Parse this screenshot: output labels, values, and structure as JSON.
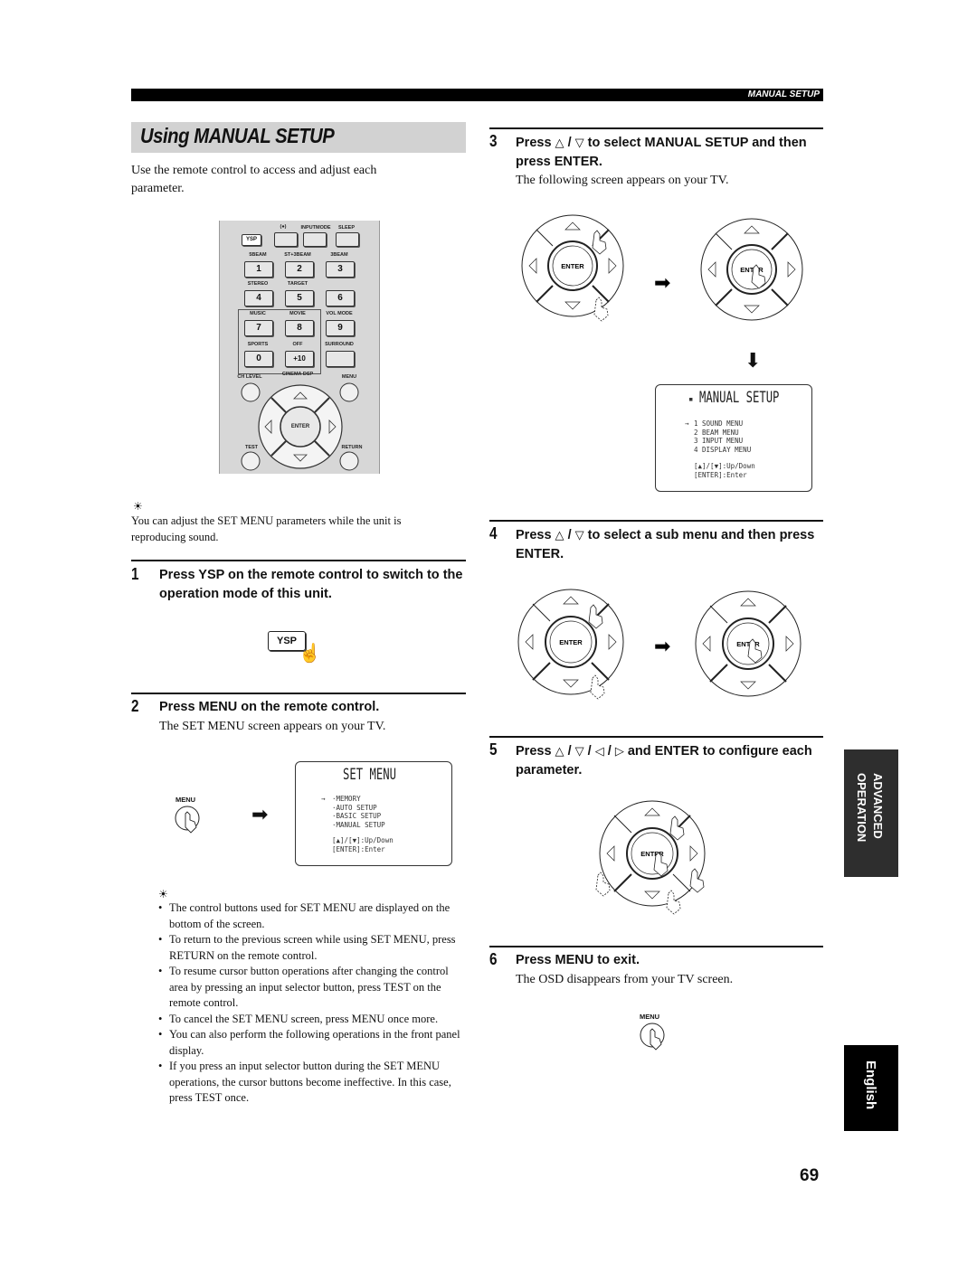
{
  "header": {
    "section_label": "MANUAL SETUP"
  },
  "title": "Using MANUAL SETUP",
  "intro": "Use the remote control to access and adjust each parameter.",
  "remote": {
    "top_labels": [
      "(●)",
      "INPUTMODE",
      "SLEEP"
    ],
    "ysp_label": "YSP",
    "row_labels_1": [
      "5BEAM",
      "ST+3BEAM",
      "3BEAM"
    ],
    "row_buttons_1": [
      "1",
      "2",
      "3"
    ],
    "row_labels_2": [
      "STEREO",
      "TARGET",
      ""
    ],
    "row_buttons_2": [
      "4",
      "5",
      "6"
    ],
    "row_labels_3": [
      "MUSIC",
      "MOVIE",
      "VOL MODE"
    ],
    "row_buttons_3": [
      "7",
      "8",
      "9"
    ],
    "row_labels_4": [
      "SPORTS",
      "OFF",
      "SURROUND"
    ],
    "row_buttons_4": [
      "0",
      "+10",
      ""
    ],
    "ch_level": "CH LEVEL",
    "cinema_dsp": "CINEMA DSP",
    "menu": "MENU",
    "enter": "ENTER",
    "test": "TEST",
    "return": "RETURN"
  },
  "tip1": {
    "icon": "tip-icon",
    "text": "You can adjust the SET MENU parameters while the unit is reproducing sound."
  },
  "steps": [
    {
      "num": "1",
      "heading": "Press YSP on the remote control to switch to the operation mode of this unit.",
      "button_label": "YSP"
    },
    {
      "num": "2",
      "heading": "Press MENU on the remote control.",
      "body": "The SET MENU screen appears on your TV.",
      "button_label": "MENU"
    },
    {
      "num": "3",
      "heading_pre": "Press",
      "heading_post": "to select MANUAL SETUP and then press ENTER.",
      "body": "The following screen appears on your TV."
    },
    {
      "num": "4",
      "heading_pre": "Press",
      "heading_post": "to select a sub menu and then press ENTER."
    },
    {
      "num": "5",
      "heading_pre": "Press",
      "heading_post": "and ENTER to configure each parameter."
    },
    {
      "num": "6",
      "heading": "Press MENU to exit.",
      "body": "The OSD disappears from your TV screen.",
      "button_label": "MENU"
    }
  ],
  "symbols": {
    "up": "△",
    "down": "▽",
    "left": "◁",
    "right": "▷",
    "sep": "/"
  },
  "set_menu_osd": {
    "title": "SET MENU",
    "cursor": "→",
    "items": [
      "·MEMORY",
      "·AUTO SETUP",
      "·BASIC SETUP",
      "·MANUAL SETUP"
    ],
    "help": [
      "[▲]/[▼]:Up/Down",
      "[ENTER]:Enter"
    ]
  },
  "manual_setup_osd": {
    "title": "MANUAL SETUP",
    "cursor": "→",
    "items": [
      "1 SOUND MENU",
      "2 BEAM MENU",
      "3 INPUT MENU",
      "4 DISPLAY MENU"
    ],
    "help": [
      "[▲]/[▼]:Up/Down",
      "[ENTER]:Enter"
    ]
  },
  "dpad_label": "ENTER",
  "tip2": {
    "bullets": [
      "The control buttons used for SET MENU are displayed on the bottom of the screen.",
      "To return to the previous screen while using SET MENU, press RETURN on the remote control.",
      "To resume cursor button operations after changing the control area by pressing an input selector button, press TEST on the remote control.",
      "To cancel the SET MENU screen, press MENU once more.",
      "You can also perform the following operations in the front panel display.",
      "If you press an input selector button during the SET MENU operations, the cursor buttons become ineffective. In this case, press TEST once."
    ]
  },
  "side_tabs": {
    "advanced_1": "ADVANCED",
    "advanced_2": "OPERATION",
    "language": "English"
  },
  "page_number": "69"
}
